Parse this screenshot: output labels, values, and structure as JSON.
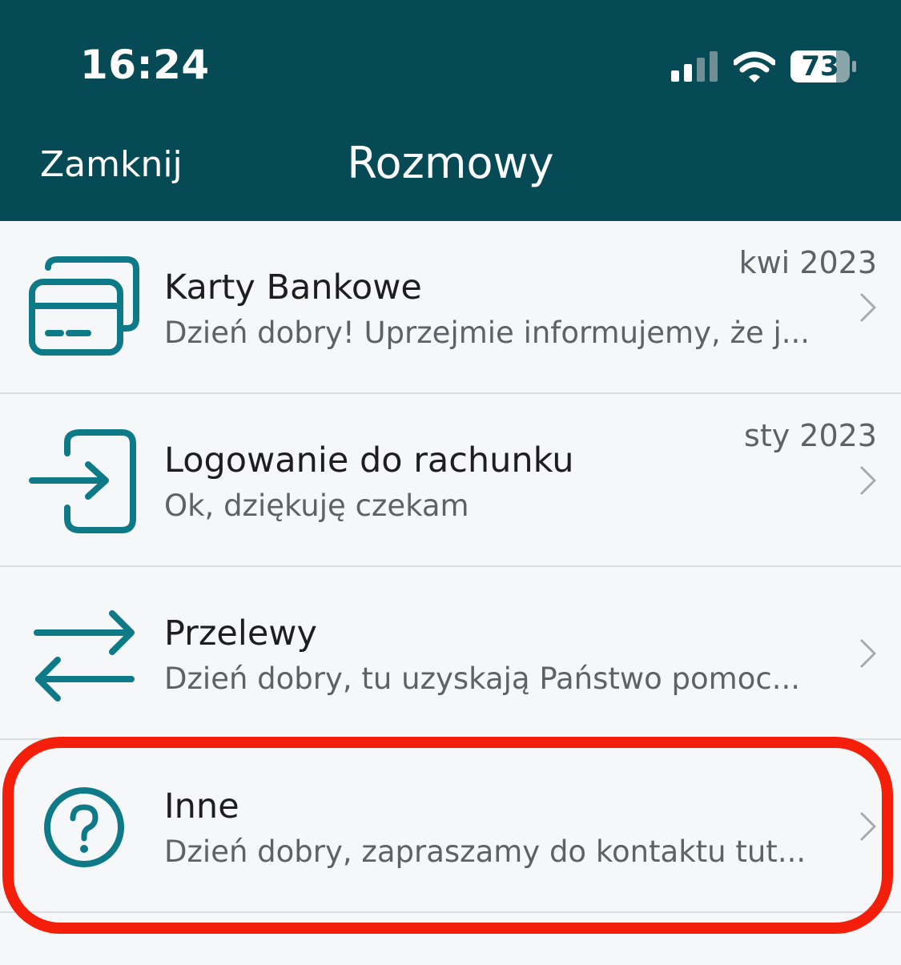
{
  "status_bar": {
    "time": "16:24",
    "battery": "73",
    "signal_icon": "cellular-signal-icon",
    "wifi_icon": "wifi-icon",
    "battery_icon": "battery-icon"
  },
  "nav": {
    "close_label": "Zamknij",
    "title": "Rozmowy"
  },
  "conversations": [
    {
      "icon": "bank-cards-icon",
      "title": "Karty Bankowe",
      "snippet": "Dzień dobry! Uprzejmie informujemy, że j...",
      "date": "kwi 2023"
    },
    {
      "icon": "login-icon",
      "title": "Logowanie do rachunku",
      "snippet": "Ok, dziękuję czekam",
      "date": "sty 2023"
    },
    {
      "icon": "transfer-arrows-icon",
      "title": "Przelewy",
      "snippet": "Dzień dobry, tu uzyskają Państwo pomoc...",
      "date": ""
    },
    {
      "icon": "question-circle-icon",
      "title": "Inne",
      "snippet": "Dzień dobry, zapraszamy do kontaktu tut...",
      "date": ""
    }
  ],
  "colors": {
    "header_bg": "#064a55",
    "icon_teal": "#0f7a87",
    "highlight_red": "#f31f0a",
    "list_bg": "#f6f7f8"
  }
}
